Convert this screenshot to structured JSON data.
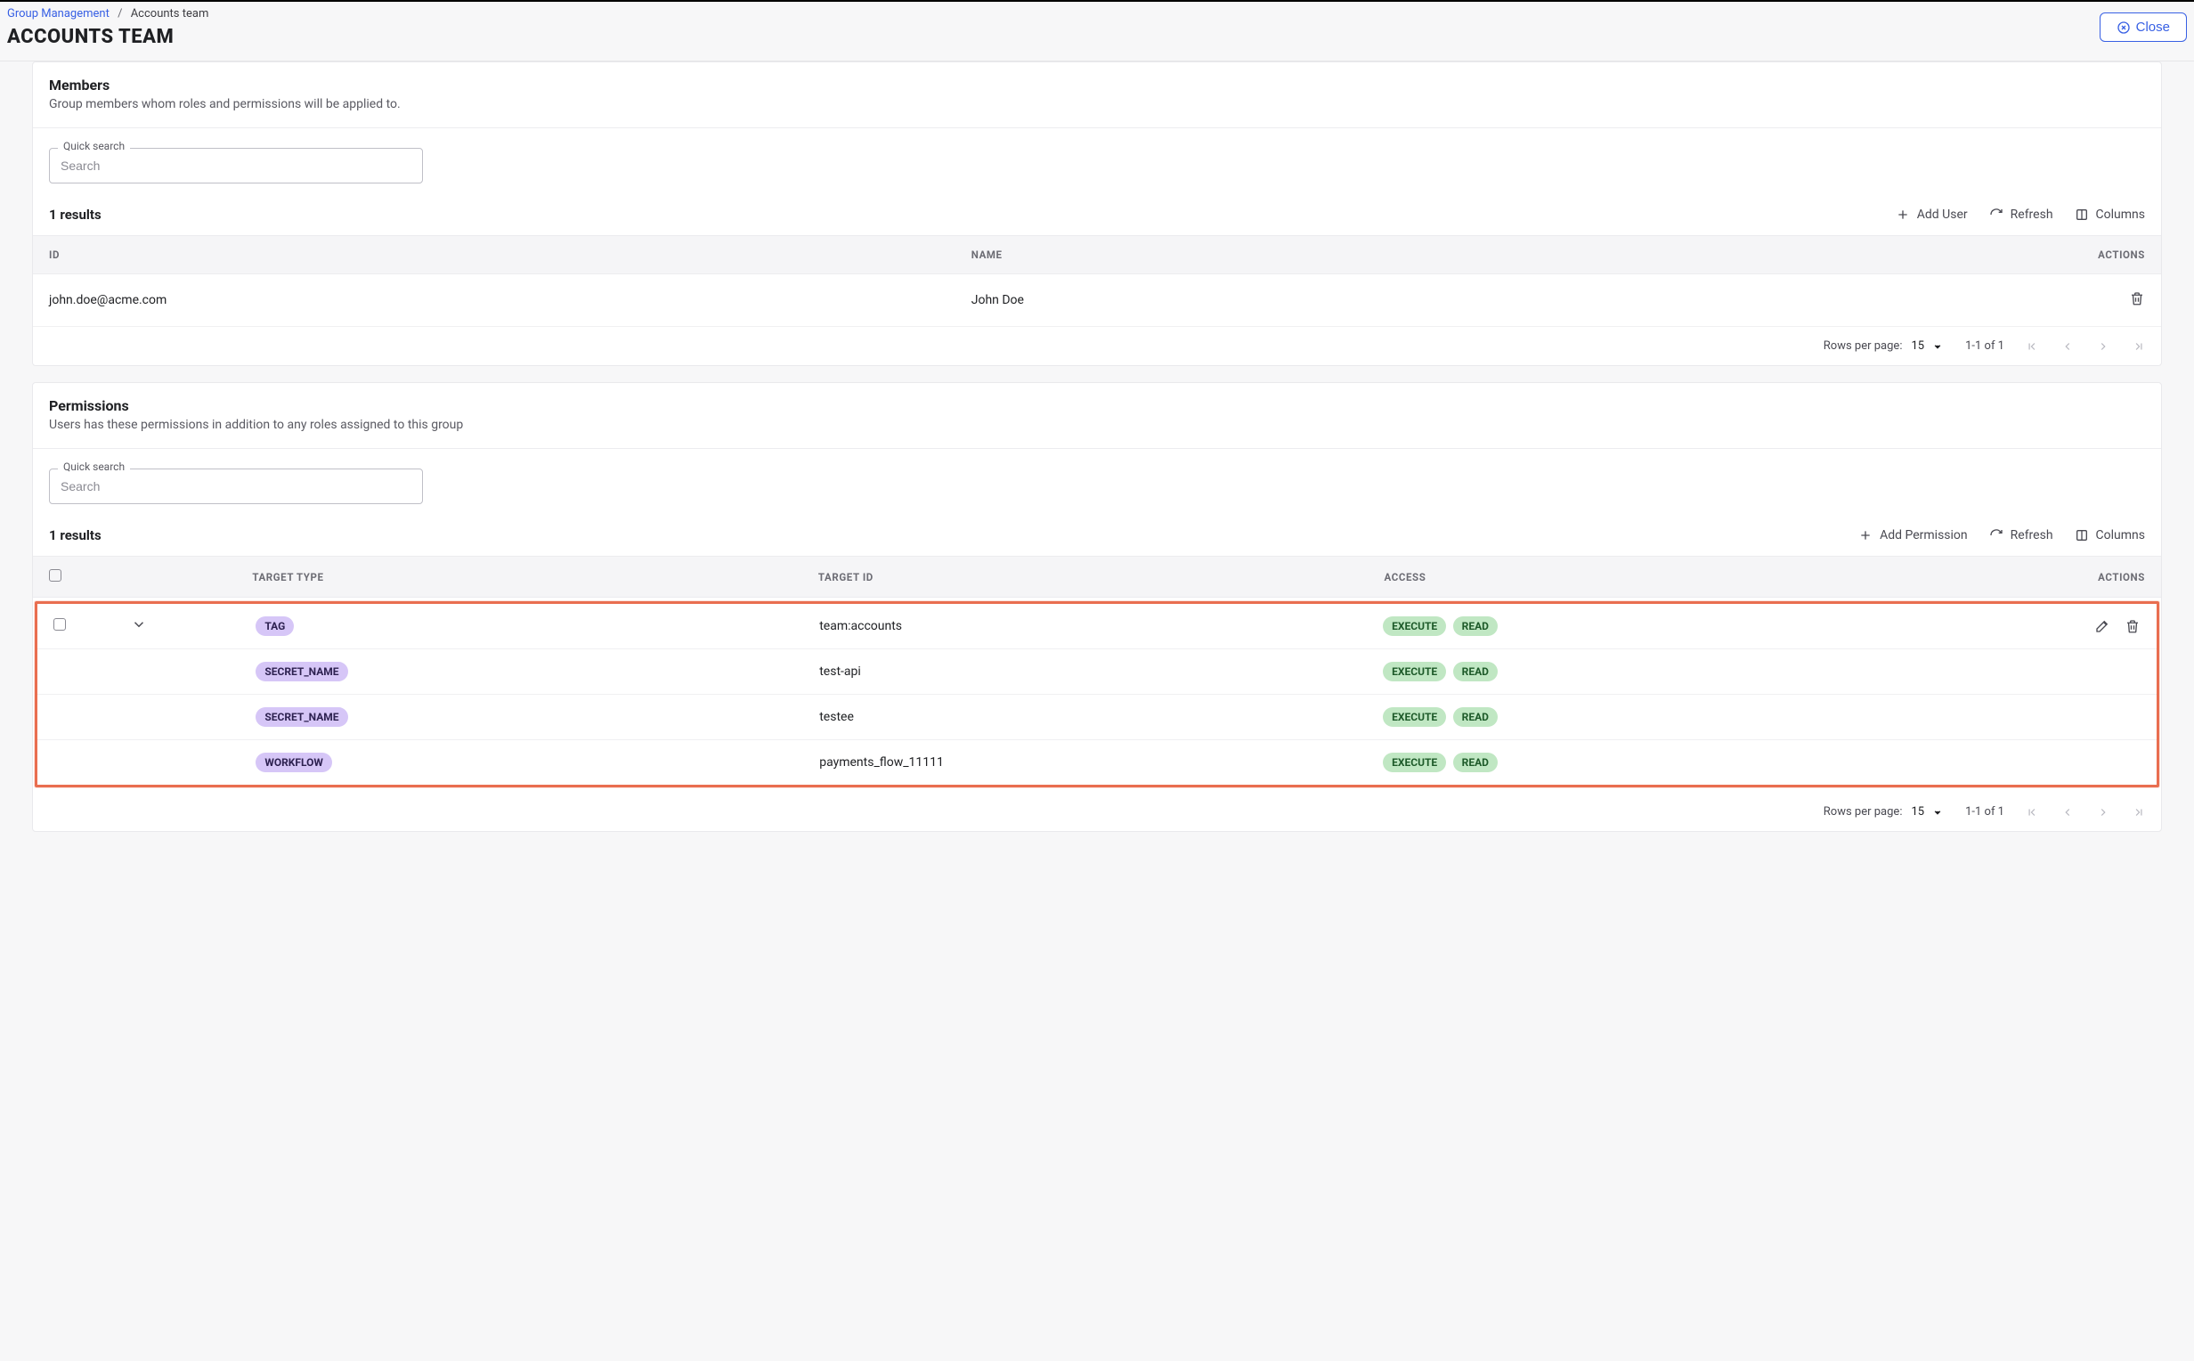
{
  "header": {
    "breadcrumb_root": "Group Management",
    "breadcrumb_current": "Accounts team",
    "page_title": "ACCOUNTS TEAM",
    "close_label": "Close"
  },
  "members": {
    "section_title": "Members",
    "section_sub": "Group members whom roles and permissions will be applied to.",
    "search_label": "Quick search",
    "search_placeholder": "Search",
    "results_text": "1 results",
    "actions": {
      "add": "Add User",
      "refresh": "Refresh",
      "columns": "Columns"
    },
    "columns": {
      "id": "ID",
      "name": "NAME",
      "actions": "ACTIONS"
    },
    "rows": [
      {
        "id": "john.doe@acme.com",
        "name": "John Doe"
      }
    ],
    "pagination": {
      "rows_label": "Rows per page:",
      "rows_value": "15",
      "range": "1-1 of 1"
    }
  },
  "permissions": {
    "section_title": "Permissions",
    "section_sub": "Users has these permissions in addition to any roles assigned to this group",
    "search_label": "Quick search",
    "search_placeholder": "Search",
    "results_text": "1 results",
    "actions": {
      "add": "Add Permission",
      "refresh": "Refresh",
      "columns": "Columns"
    },
    "columns": {
      "target_type": "TARGET TYPE",
      "target_id": "TARGET ID",
      "access": "ACCESS",
      "actions": "ACTIONS"
    },
    "rows": [
      {
        "type": "TAG",
        "id": "team:accounts",
        "access": [
          "EXECUTE",
          "READ"
        ],
        "checkbox": true,
        "expand": true,
        "row_actions": true
      },
      {
        "type": "SECRET_NAME",
        "id": "test-api",
        "access": [
          "EXECUTE",
          "READ"
        ],
        "checkbox": false,
        "expand": false,
        "row_actions": false
      },
      {
        "type": "SECRET_NAME",
        "id": "testee",
        "access": [
          "EXECUTE",
          "READ"
        ],
        "checkbox": false,
        "expand": false,
        "row_actions": false
      },
      {
        "type": "WORKFLOW",
        "id": "payments_flow_11111",
        "access": [
          "EXECUTE",
          "READ"
        ],
        "checkbox": false,
        "expand": false,
        "row_actions": false
      }
    ],
    "pagination": {
      "rows_label": "Rows per page:",
      "rows_value": "15",
      "range": "1-1 of 1"
    }
  }
}
